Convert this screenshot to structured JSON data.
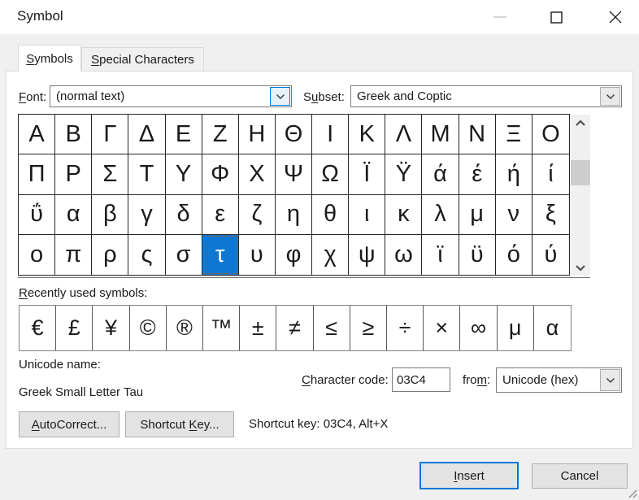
{
  "window": {
    "title": "Symbol"
  },
  "titlebar": {
    "icons": {
      "minimize": "dash-icon",
      "maximize": "square-outline-icon",
      "close": "x-icon"
    }
  },
  "tabs": {
    "symbols": {
      "accel": "S",
      "post": "ymbols"
    },
    "special": {
      "accel": "S",
      "post": "pecial Characters"
    }
  },
  "font_row": {
    "font_label": {
      "accel": "F",
      "post": "ont:"
    },
    "font_value": "(normal text)",
    "subset_label": {
      "pre": "S",
      "accel": "u",
      "post": "bset:"
    },
    "subset_value": "Greek and Coptic"
  },
  "symbol_grid": {
    "rows": [
      [
        "Α",
        "Β",
        "Γ",
        "Δ",
        "Ε",
        "Ζ",
        "Η",
        "Θ",
        "Ι",
        "Κ",
        "Λ",
        "Μ",
        "Ν",
        "Ξ",
        "Ο"
      ],
      [
        "Π",
        "Ρ",
        "Σ",
        "Τ",
        "Υ",
        "Φ",
        "Χ",
        "Ψ",
        "Ω",
        "Ϊ",
        "Ϋ",
        "ά",
        "έ",
        "ή",
        "ί"
      ],
      [
        "ΰ",
        "α",
        "β",
        "γ",
        "δ",
        "ε",
        "ζ",
        "η",
        "θ",
        "ι",
        "κ",
        "λ",
        "μ",
        "ν",
        "ξ"
      ],
      [
        "ο",
        "π",
        "ρ",
        "ς",
        "σ",
        "τ",
        "υ",
        "φ",
        "χ",
        "ψ",
        "ω",
        "ϊ",
        "ϋ",
        "ό",
        "ύ"
      ]
    ],
    "selected": {
      "row": 3,
      "col": 5,
      "char": "τ"
    }
  },
  "scrollbar": {
    "up_icon": "chevron-up",
    "down_icon": "chevron-down"
  },
  "recent": {
    "label": {
      "accel": "R",
      "post": "ecently used symbols:"
    },
    "symbols": [
      "€",
      "£",
      "¥",
      "©",
      "®",
      "™",
      "±",
      "≠",
      "≤",
      "≥",
      "÷",
      "×",
      "∞",
      "μ",
      "α"
    ]
  },
  "details": {
    "unicode_name_label": "Unicode name:",
    "unicode_name_value": "Greek Small Letter Tau",
    "char_code_label": {
      "accel": "C",
      "post": "haracter code:"
    },
    "char_code_value": "03C4",
    "from_label": {
      "pre": "fro",
      "accel": "m",
      "post": ":"
    },
    "from_value": "Unicode (hex)",
    "shortcut_text": "Shortcut key: 03C4, Alt+X"
  },
  "buttons": {
    "autocorrect": {
      "accel": "A",
      "post": "utoCorrect..."
    },
    "shortcut_key": {
      "pre": "Shortcut ",
      "accel": "K",
      "post": "ey..."
    },
    "insert": {
      "accel": "I",
      "post": "nsert"
    },
    "cancel": {
      "pre": "Cancel"
    }
  },
  "colors": {
    "accent": "#0078d7",
    "selected_cell_bg": "#0e77d2",
    "dialog_bg": "#f0f0f0",
    "combo_focus_bg": "#e5f1fb"
  }
}
